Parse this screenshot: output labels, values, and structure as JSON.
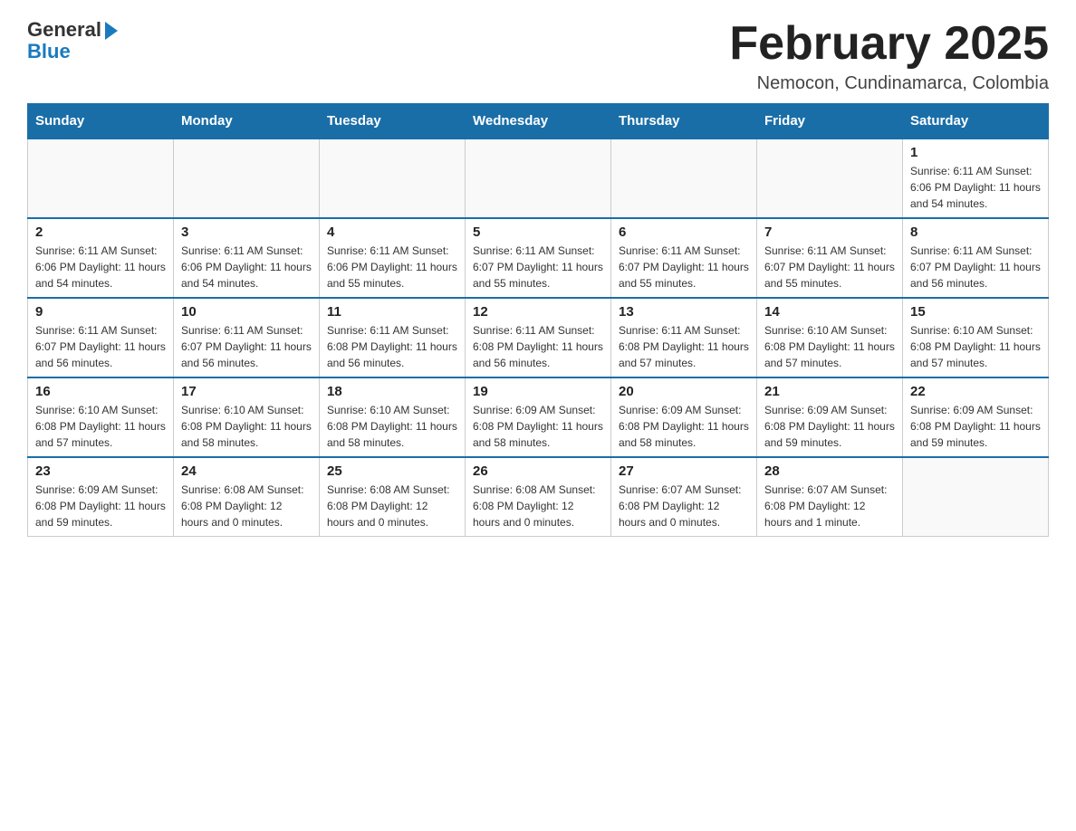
{
  "logo": {
    "general_text": "General",
    "blue_text": "Blue"
  },
  "header": {
    "month_year": "February 2025",
    "location": "Nemocon, Cundinamarca, Colombia"
  },
  "weekdays": [
    "Sunday",
    "Monday",
    "Tuesday",
    "Wednesday",
    "Thursday",
    "Friday",
    "Saturday"
  ],
  "weeks": [
    [
      {
        "day": "",
        "info": ""
      },
      {
        "day": "",
        "info": ""
      },
      {
        "day": "",
        "info": ""
      },
      {
        "day": "",
        "info": ""
      },
      {
        "day": "",
        "info": ""
      },
      {
        "day": "",
        "info": ""
      },
      {
        "day": "1",
        "info": "Sunrise: 6:11 AM\nSunset: 6:06 PM\nDaylight: 11 hours\nand 54 minutes."
      }
    ],
    [
      {
        "day": "2",
        "info": "Sunrise: 6:11 AM\nSunset: 6:06 PM\nDaylight: 11 hours\nand 54 minutes."
      },
      {
        "day": "3",
        "info": "Sunrise: 6:11 AM\nSunset: 6:06 PM\nDaylight: 11 hours\nand 54 minutes."
      },
      {
        "day": "4",
        "info": "Sunrise: 6:11 AM\nSunset: 6:06 PM\nDaylight: 11 hours\nand 55 minutes."
      },
      {
        "day": "5",
        "info": "Sunrise: 6:11 AM\nSunset: 6:07 PM\nDaylight: 11 hours\nand 55 minutes."
      },
      {
        "day": "6",
        "info": "Sunrise: 6:11 AM\nSunset: 6:07 PM\nDaylight: 11 hours\nand 55 minutes."
      },
      {
        "day": "7",
        "info": "Sunrise: 6:11 AM\nSunset: 6:07 PM\nDaylight: 11 hours\nand 55 minutes."
      },
      {
        "day": "8",
        "info": "Sunrise: 6:11 AM\nSunset: 6:07 PM\nDaylight: 11 hours\nand 56 minutes."
      }
    ],
    [
      {
        "day": "9",
        "info": "Sunrise: 6:11 AM\nSunset: 6:07 PM\nDaylight: 11 hours\nand 56 minutes."
      },
      {
        "day": "10",
        "info": "Sunrise: 6:11 AM\nSunset: 6:07 PM\nDaylight: 11 hours\nand 56 minutes."
      },
      {
        "day": "11",
        "info": "Sunrise: 6:11 AM\nSunset: 6:08 PM\nDaylight: 11 hours\nand 56 minutes."
      },
      {
        "day": "12",
        "info": "Sunrise: 6:11 AM\nSunset: 6:08 PM\nDaylight: 11 hours\nand 56 minutes."
      },
      {
        "day": "13",
        "info": "Sunrise: 6:11 AM\nSunset: 6:08 PM\nDaylight: 11 hours\nand 57 minutes."
      },
      {
        "day": "14",
        "info": "Sunrise: 6:10 AM\nSunset: 6:08 PM\nDaylight: 11 hours\nand 57 minutes."
      },
      {
        "day": "15",
        "info": "Sunrise: 6:10 AM\nSunset: 6:08 PM\nDaylight: 11 hours\nand 57 minutes."
      }
    ],
    [
      {
        "day": "16",
        "info": "Sunrise: 6:10 AM\nSunset: 6:08 PM\nDaylight: 11 hours\nand 57 minutes."
      },
      {
        "day": "17",
        "info": "Sunrise: 6:10 AM\nSunset: 6:08 PM\nDaylight: 11 hours\nand 58 minutes."
      },
      {
        "day": "18",
        "info": "Sunrise: 6:10 AM\nSunset: 6:08 PM\nDaylight: 11 hours\nand 58 minutes."
      },
      {
        "day": "19",
        "info": "Sunrise: 6:09 AM\nSunset: 6:08 PM\nDaylight: 11 hours\nand 58 minutes."
      },
      {
        "day": "20",
        "info": "Sunrise: 6:09 AM\nSunset: 6:08 PM\nDaylight: 11 hours\nand 58 minutes."
      },
      {
        "day": "21",
        "info": "Sunrise: 6:09 AM\nSunset: 6:08 PM\nDaylight: 11 hours\nand 59 minutes."
      },
      {
        "day": "22",
        "info": "Sunrise: 6:09 AM\nSunset: 6:08 PM\nDaylight: 11 hours\nand 59 minutes."
      }
    ],
    [
      {
        "day": "23",
        "info": "Sunrise: 6:09 AM\nSunset: 6:08 PM\nDaylight: 11 hours\nand 59 minutes."
      },
      {
        "day": "24",
        "info": "Sunrise: 6:08 AM\nSunset: 6:08 PM\nDaylight: 12 hours\nand 0 minutes."
      },
      {
        "day": "25",
        "info": "Sunrise: 6:08 AM\nSunset: 6:08 PM\nDaylight: 12 hours\nand 0 minutes."
      },
      {
        "day": "26",
        "info": "Sunrise: 6:08 AM\nSunset: 6:08 PM\nDaylight: 12 hours\nand 0 minutes."
      },
      {
        "day": "27",
        "info": "Sunrise: 6:07 AM\nSunset: 6:08 PM\nDaylight: 12 hours\nand 0 minutes."
      },
      {
        "day": "28",
        "info": "Sunrise: 6:07 AM\nSunset: 6:08 PM\nDaylight: 12 hours\nand 1 minute."
      },
      {
        "day": "",
        "info": ""
      }
    ]
  ]
}
